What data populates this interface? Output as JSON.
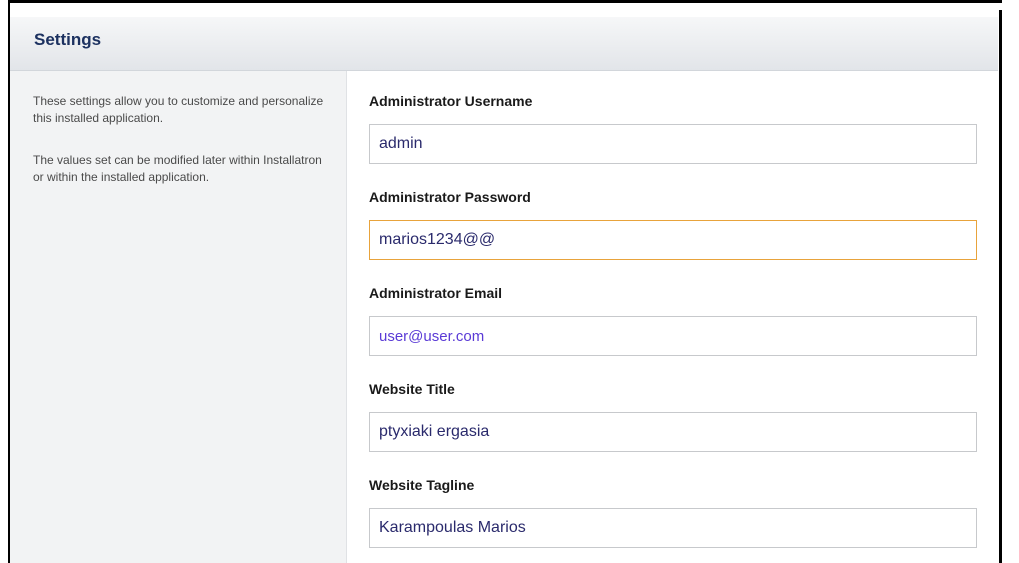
{
  "settings": {
    "title": "Settings",
    "description": [
      "These settings allow you to customize and personalize this installed application.",
      "The values set can be modified later within Installatron or within the installed application."
    ],
    "fields": [
      {
        "label": "Administrator Username",
        "value": "admin"
      },
      {
        "label": "Administrator Password",
        "value": "marios1234@@"
      },
      {
        "label": "Administrator Email",
        "value": "user@user.com"
      },
      {
        "label": "Website Title",
        "value": "ptyxiaki ergasia"
      },
      {
        "label": "Website Tagline",
        "value": "Karampoulas Marios"
      }
    ]
  },
  "colors": {
    "header_text": "#1c3160",
    "focus_border": "#e8a33b",
    "input_text": "#2a2a6c",
    "email_text": "#5a3ad6"
  }
}
